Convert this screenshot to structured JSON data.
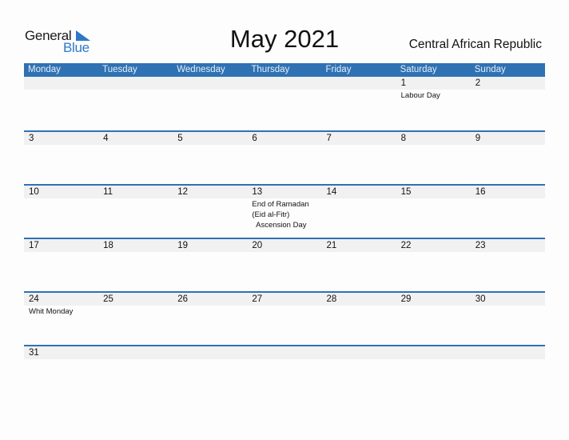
{
  "brand": {
    "word1": "General",
    "word2": "Blue",
    "color": "#2d79c7"
  },
  "title": "May 2021",
  "country": "Central African Republic",
  "colors": {
    "header_bg": "#2e72b3",
    "band_bg": "#f1f1f1"
  },
  "weekdays": [
    "Monday",
    "Tuesday",
    "Wednesday",
    "Thursday",
    "Friday",
    "Saturday",
    "Sunday"
  ],
  "weeks": [
    [
      {
        "day": "",
        "events": []
      },
      {
        "day": "",
        "events": []
      },
      {
        "day": "",
        "events": []
      },
      {
        "day": "",
        "events": []
      },
      {
        "day": "",
        "events": []
      },
      {
        "day": "1",
        "events": [
          "Labour Day"
        ]
      },
      {
        "day": "2",
        "events": []
      }
    ],
    [
      {
        "day": "3",
        "events": []
      },
      {
        "day": "4",
        "events": []
      },
      {
        "day": "5",
        "events": []
      },
      {
        "day": "6",
        "events": []
      },
      {
        "day": "7",
        "events": []
      },
      {
        "day": "8",
        "events": []
      },
      {
        "day": "9",
        "events": []
      }
    ],
    [
      {
        "day": "10",
        "events": []
      },
      {
        "day": "11",
        "events": []
      },
      {
        "day": "12",
        "events": []
      },
      {
        "day": "13",
        "events": [
          "End of Ramadan",
          "(Eid al-Fitr)",
          "  Ascension Day"
        ]
      },
      {
        "day": "14",
        "events": []
      },
      {
        "day": "15",
        "events": []
      },
      {
        "day": "16",
        "events": []
      }
    ],
    [
      {
        "day": "17",
        "events": []
      },
      {
        "day": "18",
        "events": []
      },
      {
        "day": "19",
        "events": []
      },
      {
        "day": "20",
        "events": []
      },
      {
        "day": "21",
        "events": []
      },
      {
        "day": "22",
        "events": []
      },
      {
        "day": "23",
        "events": []
      }
    ],
    [
      {
        "day": "24",
        "events": [
          "Whit Monday"
        ]
      },
      {
        "day": "25",
        "events": []
      },
      {
        "day": "26",
        "events": []
      },
      {
        "day": "27",
        "events": []
      },
      {
        "day": "28",
        "events": []
      },
      {
        "day": "29",
        "events": []
      },
      {
        "day": "30",
        "events": []
      }
    ],
    [
      {
        "day": "31",
        "events": []
      },
      {
        "day": "",
        "events": []
      },
      {
        "day": "",
        "events": []
      },
      {
        "day": "",
        "events": []
      },
      {
        "day": "",
        "events": []
      },
      {
        "day": "",
        "events": []
      },
      {
        "day": "",
        "events": []
      }
    ]
  ]
}
